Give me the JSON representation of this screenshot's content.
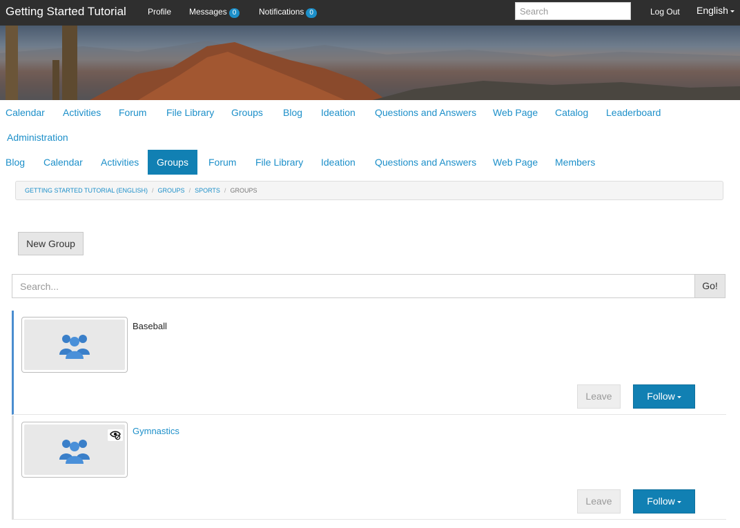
{
  "header": {
    "brand": "Getting Started Tutorial",
    "profile": "Profile",
    "messages": "Messages",
    "messages_count": "0",
    "notifications": "Notifications",
    "notifications_count": "0",
    "search_placeholder": "Search",
    "logout": "Log Out",
    "language": "English"
  },
  "main_nav": [
    "Calendar",
    "Activities",
    "Forum",
    "File Library",
    "Groups",
    "Blog",
    "Ideation",
    "Questions and Answers",
    "Web Page",
    "Catalog",
    "Leaderboard",
    "Administration"
  ],
  "group_tabs": [
    "Blog",
    "Calendar",
    "Activities",
    "Groups",
    "Forum",
    "File Library",
    "Ideation",
    "Questions and Answers",
    "Web Page",
    "Members"
  ],
  "active_tab": "Groups",
  "breadcrumb": [
    "Getting Started Tutorial (English)",
    "Groups",
    "Sports",
    "Groups"
  ],
  "new_group_label": "New Group",
  "search": {
    "placeholder": "Search...",
    "go_label": "Go!"
  },
  "groups": [
    {
      "name": "Baseball",
      "leave_label": "Leave",
      "follow_label": "Follow"
    },
    {
      "name": "Gymnastics",
      "leave_label": "Leave",
      "follow_label": "Follow"
    }
  ],
  "colors": {
    "accent": "#1c8fc9",
    "active_tab": "#1180b3",
    "topbar": "#2f2f2f"
  }
}
